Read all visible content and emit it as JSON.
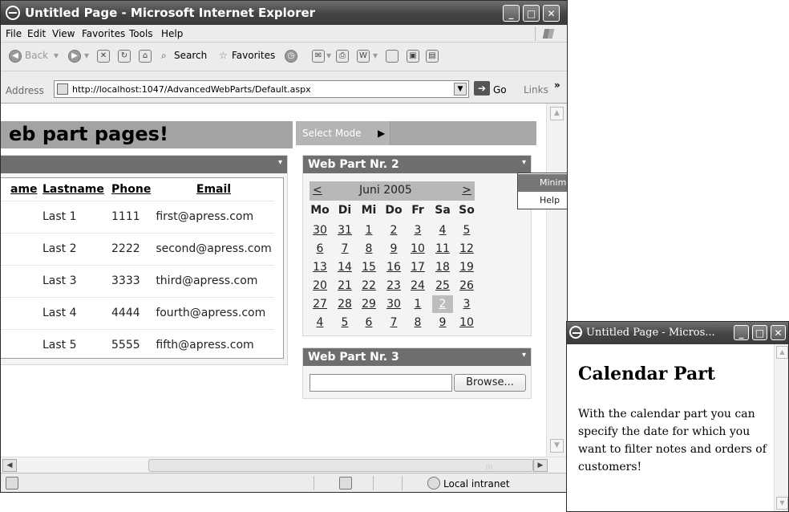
{
  "main_window": {
    "title": "Untitled Page - Microsoft Internet Explorer",
    "minimize": "_",
    "maximize": "□",
    "close": "✕"
  },
  "menu": [
    "File",
    "Edit",
    "View",
    "Favorites",
    "Tools",
    "Help"
  ],
  "toolbar": {
    "back_label": "Back",
    "search_label": "Search",
    "favorites_label": "Favorites"
  },
  "address": {
    "label": "Address",
    "url": "http://localhost:1047/AdvancedWebParts/Default.aspx",
    "go_label": "Go",
    "links_label": "Links"
  },
  "page": {
    "heading": "eb part pages!",
    "select_mode_label": "Select Mode"
  },
  "webpart1": {
    "title": "",
    "columns": [
      "ame",
      "Lastname",
      "Phone",
      "Email"
    ],
    "rows": [
      {
        "firstname": "",
        "lastname": "Last 1",
        "phone": "1111",
        "email": "first@apress.com"
      },
      {
        "firstname": "",
        "lastname": "Last 2",
        "phone": "2222",
        "email": "second@apress.com"
      },
      {
        "firstname": "",
        "lastname": "Last 3",
        "phone": "3333",
        "email": "third@apress.com"
      },
      {
        "firstname": "",
        "lastname": "Last 4",
        "phone": "4444",
        "email": "fourth@apress.com"
      },
      {
        "firstname": "",
        "lastname": "Last 5",
        "phone": "5555",
        "email": "fifth@apress.com"
      }
    ]
  },
  "webpart2": {
    "title": "Web Part Nr. 2",
    "calendar": {
      "prev": "<",
      "next": ">",
      "month": "Juni 2005",
      "weekdays": [
        "Mo",
        "Di",
        "Mi",
        "Do",
        "Fr",
        "Sa",
        "So"
      ],
      "weeks": [
        [
          "30",
          "31",
          "1",
          "2",
          "3",
          "4",
          "5"
        ],
        [
          "6",
          "7",
          "8",
          "9",
          "10",
          "11",
          "12"
        ],
        [
          "13",
          "14",
          "15",
          "16",
          "17",
          "18",
          "19"
        ],
        [
          "20",
          "21",
          "22",
          "23",
          "24",
          "25",
          "26"
        ],
        [
          "27",
          "28",
          "29",
          "30",
          "1",
          "2",
          "3"
        ],
        [
          "4",
          "5",
          "6",
          "7",
          "8",
          "9",
          "10"
        ]
      ],
      "selected_day": "2"
    },
    "verbs_menu": {
      "minimize": "Minimize",
      "help": "Help"
    }
  },
  "webpart3": {
    "title": "Web Part Nr. 3",
    "file_value": "",
    "browse_label": "Browse..."
  },
  "status": {
    "zone": "Local intranet"
  },
  "popup_window": {
    "title": "Untitled Page - Micros...",
    "heading": "Calendar Part",
    "body": "With the calendar part you can specify the date for which you want to filter notes and orders of customers!"
  }
}
